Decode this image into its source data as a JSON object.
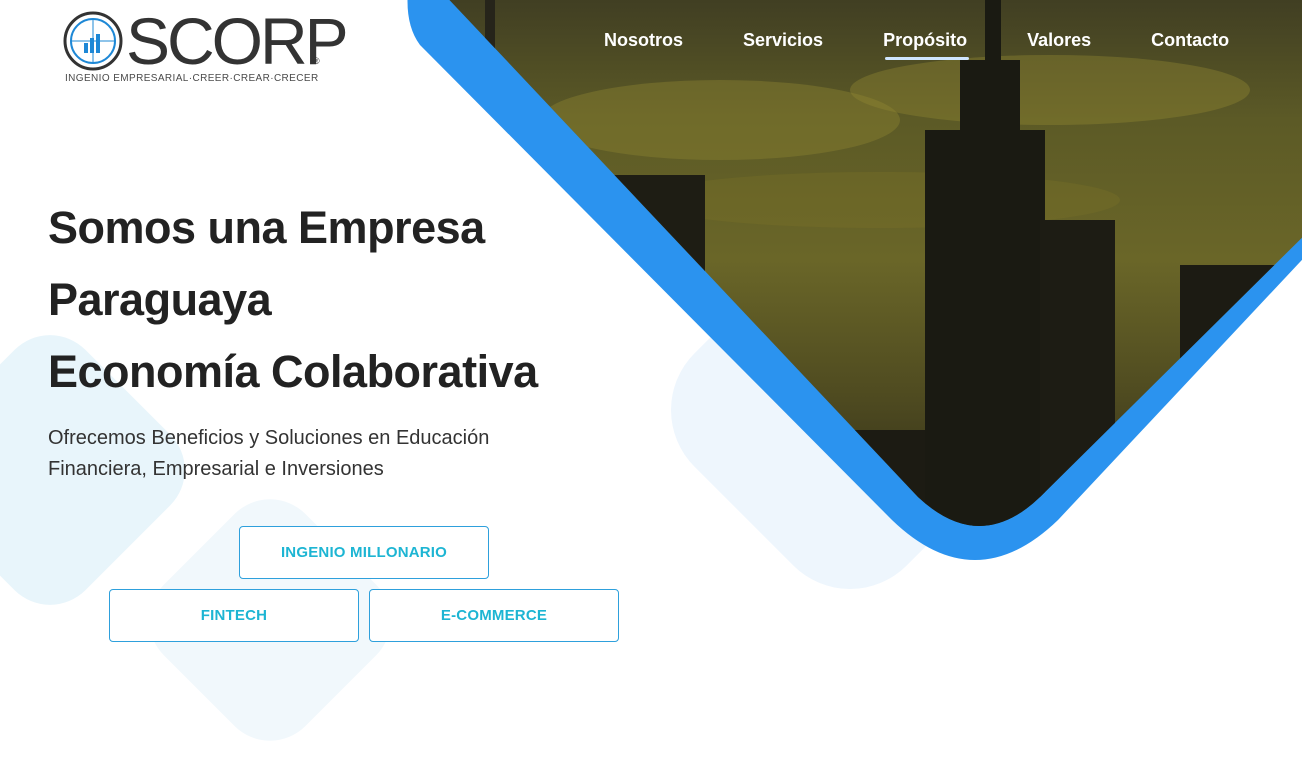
{
  "brand": {
    "wordmark": "SCORP",
    "tagline": "INGENIO EMPRESARIAL·CREER·CREAR·CRECER",
    "registered": "®",
    "colors": {
      "logo_blue": "#1e88d6",
      "logo_gray": "#333333"
    }
  },
  "nav": {
    "items": [
      {
        "label": "Nosotros",
        "active": false
      },
      {
        "label": "Servicios",
        "active": false
      },
      {
        "label": "Propósito",
        "active": true
      },
      {
        "label": "Valores",
        "active": false
      },
      {
        "label": "Contacto",
        "active": false
      }
    ]
  },
  "hero": {
    "title_lines": [
      "Somos una Empresa",
      "Paraguaya",
      "Economía Colaborativa"
    ],
    "subtitle": "Ofrecemos Beneficios y Soluciones en Educación Financiera, Empresarial e Inversiones",
    "image_icon": "city-skyline-sunset-photo",
    "accent": "#2b93ef"
  },
  "buttons": {
    "ingenio": "INGENIO MILLONARIO",
    "fintech": "FINTECH",
    "ecommerce": "E-COMMERCE"
  }
}
